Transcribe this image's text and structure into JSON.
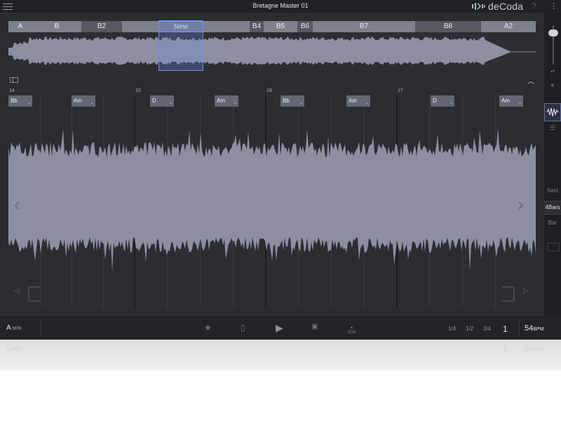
{
  "app": {
    "title": "Bretagne Master 01",
    "brand": "deCoda"
  },
  "sections": [
    {
      "label": "A"
    },
    {
      "label": "B"
    },
    {
      "label": "B2"
    },
    {
      "label": ""
    },
    {
      "label": "New"
    },
    {
      "label": ""
    },
    {
      "label": "B4"
    },
    {
      "label": "B5"
    },
    {
      "label": "B6"
    },
    {
      "label": "B7"
    },
    {
      "label": "B8"
    },
    {
      "label": "A2"
    }
  ],
  "bars": [
    "14",
    "15",
    "16",
    "17"
  ],
  "chords": [
    {
      "name": "Bb"
    },
    {
      "name": "Am"
    },
    {
      "name": "D"
    },
    {
      "name": "Am"
    },
    {
      "name": "Bb"
    },
    {
      "name": "Am"
    },
    {
      "name": "D"
    },
    {
      "name": "Am"
    }
  ],
  "rail": {
    "view_options": [
      "Sect",
      "4Bars",
      "Bar"
    ],
    "selected_view": "4Bars"
  },
  "transport": {
    "key": "A",
    "key_mode": "MIN",
    "octave_label": "Oct",
    "speeds": [
      "1/4",
      "1/2",
      "3/4"
    ],
    "selected_speed": "1",
    "bpm": "54",
    "bpm_unit": "BPM"
  },
  "icons": {
    "menu": "hamburger-menu-icon",
    "help": "question-icon",
    "more": "vertical-dots-icon",
    "panel": "panel-toggle-icon",
    "collapse": "chevron-up-icon",
    "prev": "chevron-left-icon",
    "next": "chevron-right-icon",
    "star": "star-icon",
    "metronome": "metronome-icon",
    "play": "play-icon",
    "loop": "loop-icon"
  },
  "colors": {
    "background": "#2b2c30",
    "waveform": "#8b8fa0",
    "selection": "#6f8cf0",
    "section_block": "#7d818c",
    "chord_block": "#636773"
  }
}
